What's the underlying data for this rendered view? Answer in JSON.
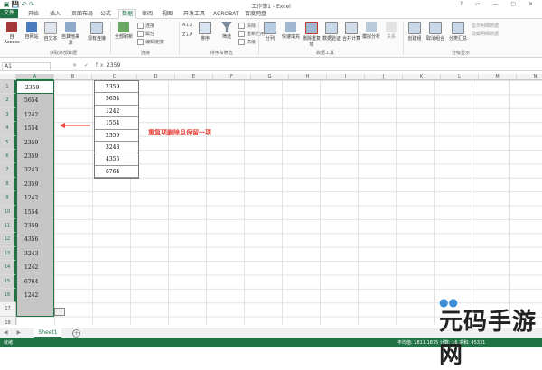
{
  "window": {
    "title": "工作簿1 - Excel",
    "controls": "? ▭ — ▢ ✕"
  },
  "ribbon_tabs": [
    "文件",
    "开始",
    "插入",
    "页面布局",
    "公式",
    "数据",
    "审阅",
    "视图",
    "开发工具",
    "ACROBAT",
    "百度网盘"
  ],
  "active_tab_index": 5,
  "ribbon": {
    "external_buttons": [
      "自 Access",
      "自网站",
      "自文本",
      "自其他来源",
      "现有连接"
    ],
    "external_group": "获取外部数据",
    "refresh": "全部刷新",
    "connections": [
      "连接",
      "属性",
      "编辑链接"
    ],
    "connections_group": "连接",
    "sort_buttons": [
      "排序",
      "筛选"
    ],
    "sort_small": [
      "清除",
      "重新应用",
      "高级"
    ],
    "sort_group": "排序和筛选",
    "tools_buttons": [
      "分列",
      "快速填充",
      "删除重复项",
      "数据验证",
      "合并计算",
      "模拟分析",
      "关系"
    ],
    "tools_group": "数据工具",
    "outline_buttons": [
      "创建组",
      "取消组合",
      "分类汇总"
    ],
    "outline_small": [
      "显示明细数据",
      "隐藏明细数据"
    ],
    "outline_group": "分级显示"
  },
  "formula_bar": {
    "name_box": "A1",
    "fx_icons": "× ✓ fx",
    "value": "2359"
  },
  "columns": [
    "A",
    "B",
    "C",
    "D",
    "E",
    "F",
    "G",
    "H",
    "I",
    "J",
    "K",
    "L",
    "M",
    "N"
  ],
  "rows": [
    "1",
    "2",
    "3",
    "4",
    "5",
    "6",
    "7",
    "8",
    "9",
    "10",
    "11",
    "12",
    "13",
    "14",
    "15",
    "16",
    "17",
    "18"
  ],
  "column_a": [
    "2359",
    "5654",
    "1242",
    "1554",
    "2359",
    "2359",
    "3243",
    "2359",
    "1242",
    "1554",
    "2359",
    "4356",
    "3243",
    "1242",
    "6764",
    "1242"
  ],
  "column_c": [
    "2359",
    "5654",
    "1242",
    "1554",
    "2359",
    "3243",
    "4356",
    "6764"
  ],
  "annotation": "重复项删除且保留一项",
  "sheet_tabs": [
    "Sheet1"
  ],
  "status": {
    "ready": "就绪",
    "stats": "平均值: 2811.1875    计数: 16    求和: 45331"
  },
  "watermark": "元码手游网",
  "colors": {
    "excel_green": "#217346",
    "annotation_red": "#e8413a"
  }
}
